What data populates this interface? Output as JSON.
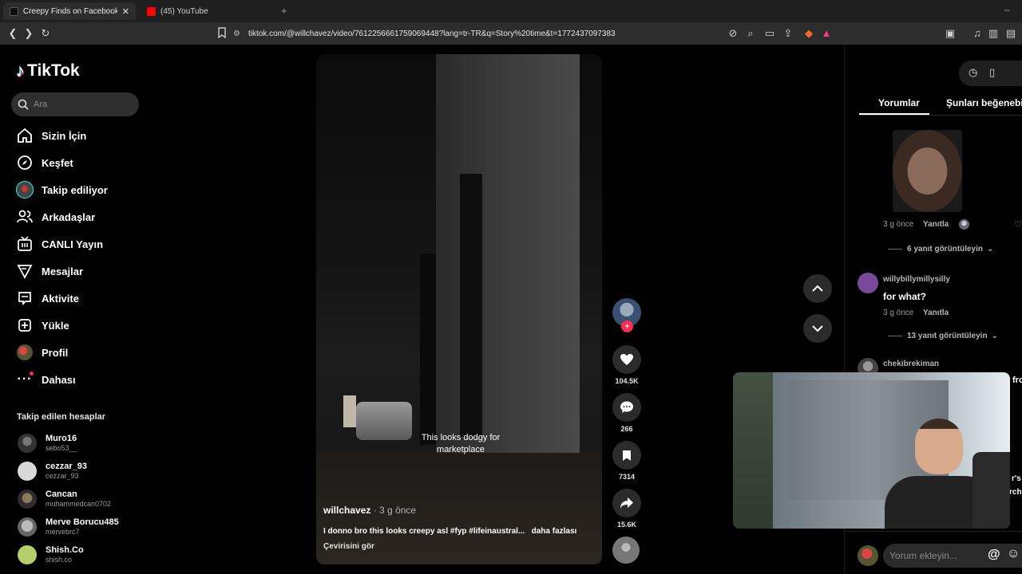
{
  "browser": {
    "tabs": [
      {
        "title": "Creepy Finds on Facebook Mark",
        "active": true
      },
      {
        "title": "(45) YouTube",
        "active": false
      }
    ],
    "url": "tiktok.com/@willchavez/video/7612256661759069448?lang=tr-TR&q=Story%20time&t=1772437097383"
  },
  "sidebar": {
    "logo": "TikTok",
    "search_placeholder": "Ara",
    "nav": [
      {
        "label": "Sizin İçin",
        "icon": "home-icon"
      },
      {
        "label": "Keşfet",
        "icon": "compass-icon"
      },
      {
        "label": "Takip ediliyor",
        "icon": "following-avatar-icon"
      },
      {
        "label": "Arkadaşlar",
        "icon": "friends-icon"
      },
      {
        "label": "CANLI Yayın",
        "icon": "live-icon"
      },
      {
        "label": "Mesajlar",
        "icon": "messages-icon"
      },
      {
        "label": "Aktivite",
        "icon": "activity-icon"
      },
      {
        "label": "Yükle",
        "icon": "upload-icon"
      },
      {
        "label": "Profil",
        "icon": "profile-avatar-icon"
      },
      {
        "label": "Dahası",
        "icon": "more-icon"
      }
    ],
    "following_heading": "Takip edilen hesaplar",
    "following": [
      {
        "name": "Muro16",
        "handle": "sebo53__"
      },
      {
        "name": "cezzar_93",
        "handle": "cezzar_93"
      },
      {
        "name": "Cancan",
        "handle": "muhammedcan0702"
      },
      {
        "name": "Merve Borucu485",
        "handle": "mervebrc7"
      },
      {
        "name": "Shish.Co",
        "handle": "shish.co"
      }
    ]
  },
  "video": {
    "caption": "This looks dodgy for marketplace",
    "author": "willchavez",
    "time": "· 3 g önce",
    "description": "I donno bro this looks creepy asl #fyp #lifeinaustral...",
    "more": "daha fazlası",
    "translate": "Çevirisini gör",
    "progress": 0.1
  },
  "actions": {
    "likes": "104.5K",
    "comments": "266",
    "saves": "7314",
    "shares": "15.6K"
  },
  "comments_panel": {
    "tabs": [
      "Yorumlar",
      "Şunları beğenebilir"
    ],
    "items": [
      {
        "meta": "3 g önce",
        "reply": "Yanıtla",
        "view_replies": "6 yanıt görüntüleyin"
      },
      {
        "user": "willybillymillysilly",
        "text": "for what?",
        "meta": "3 g önce",
        "reply": "Yanıtla",
        "view_replies": "13 yanıt görüntüleyin"
      },
      {
        "user": "chekibrekiman",
        "text": "fror"
      }
    ],
    "partial_text": [
      "r's",
      "rch"
    ],
    "input_placeholder": "Yorum ekleyin..."
  },
  "colors": {
    "accent": "#fe2c55"
  }
}
